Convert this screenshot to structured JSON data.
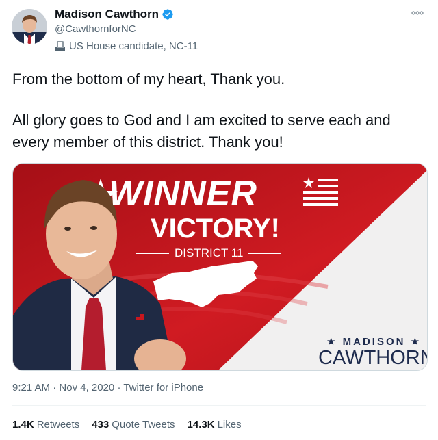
{
  "author": {
    "name": "Madison Cawthorn",
    "handle": "@CawthornforNC",
    "label": "US House candidate, NC-11"
  },
  "icons": {
    "verified": "verified-badge-icon",
    "ballot": "ballot-box-icon",
    "more": "more-options-icon"
  },
  "tweet": {
    "paragraph1": "From the bottom of my heart, Thank you.",
    "paragraph2": "All glory goes to God and I am excited to serve each and every member of this district. Thank you!"
  },
  "media": {
    "headline": "WINNER",
    "subhead": "VICTORY!",
    "district": "DISTRICT 11",
    "sign_first": "★ MADISON ★",
    "sign_last": "CAWTHORN"
  },
  "meta": {
    "time": "9:21 AM",
    "separator": "·",
    "date": "Nov 4, 2020",
    "source": "Twitter for iPhone"
  },
  "stats": {
    "retweets_count": "1.4K",
    "retweets_label": "Retweets",
    "quotes_count": "433",
    "quotes_label": "Quote Tweets",
    "likes_count": "14.3K",
    "likes_label": "Likes"
  },
  "colors": {
    "verified": "#1d9bf0",
    "banner_red": "#c8171e",
    "navy": "#1e2b4d",
    "muted_text": "#536471"
  }
}
